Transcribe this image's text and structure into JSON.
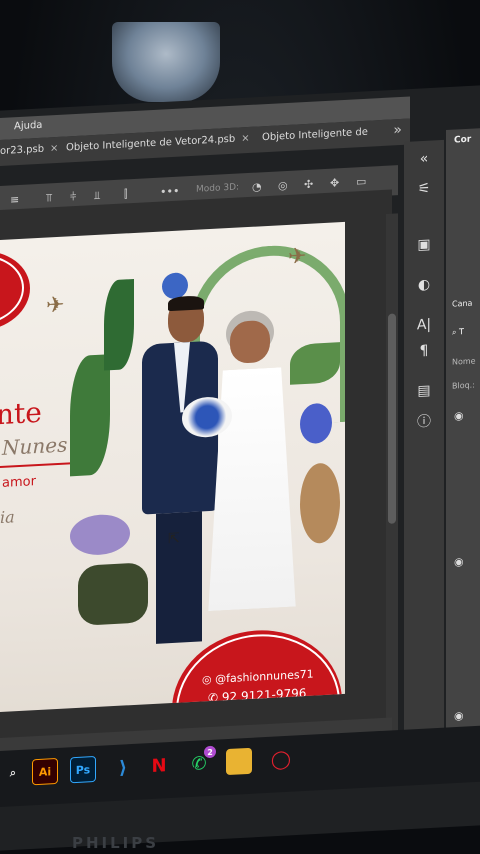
{
  "menu": {
    "help_label": "Ajuda"
  },
  "tabs": [
    {
      "label": "or23.psb",
      "close": "×"
    },
    {
      "label": "Objeto Inteligente de Vetor24.psb",
      "close": "×"
    },
    {
      "label": "Objeto Inteligente de"
    }
  ],
  "tabs_more": "»",
  "options_bar": {
    "more": "•••",
    "mode_3d": "Modo 3D:"
  },
  "artwork": {
    "title": "nte",
    "name": "Nunes",
    "subtitle": "amor",
    "signature": "ia",
    "instagram": "@fashionnunes71",
    "phone": "92 9121-9796"
  },
  "right_panel": {
    "tab_color": "Cor",
    "tab_channels": "Cana",
    "search_prefix": "T",
    "name_field": "Nome",
    "lock_label": "Bloq.:"
  },
  "taskbar": {
    "illustrator": "Ai",
    "photoshop": "Ps",
    "whatsapp_badge": "2"
  },
  "monitor_brand": "PHILIPS",
  "colors": {
    "accent_red": "#c8161c",
    "ps_blue": "#31a8ff",
    "ai_orange": "#ff9a00"
  }
}
